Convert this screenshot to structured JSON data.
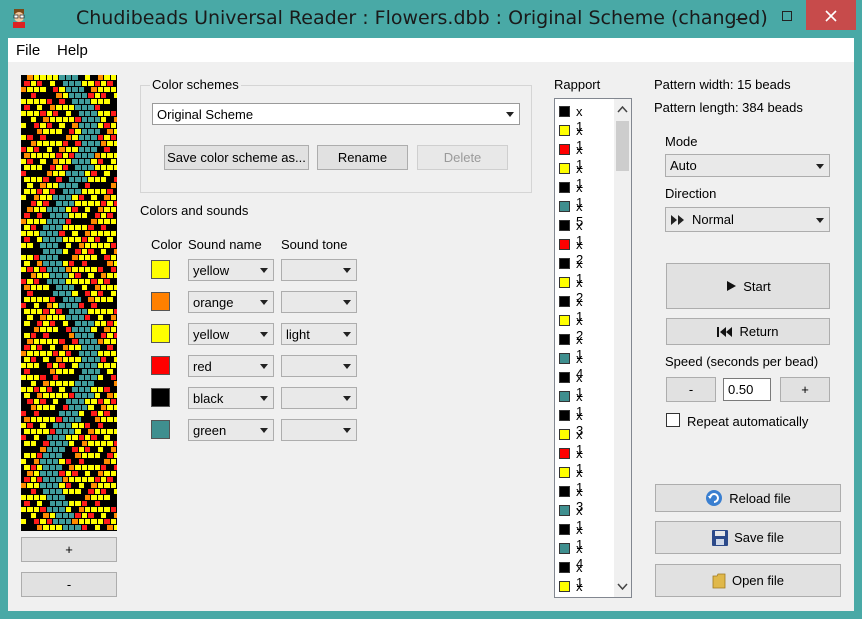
{
  "window": {
    "title": "Chudibeads Universal Reader : Flowers.dbb : Original Scheme  (changed)",
    "minimize": "—",
    "maximize": "☐",
    "close": "✕"
  },
  "menu": {
    "file": "File",
    "help": "Help"
  },
  "left_panel": {
    "plus_label": "+",
    "minus_label": "-"
  },
  "color_schemes": {
    "group_label": "Color schemes",
    "selected": "Original Scheme",
    "save_label": "Save color scheme as...",
    "rename_label": "Rename",
    "delete_label": "Delete"
  },
  "colors_sounds": {
    "section_label": "Colors and sounds",
    "header_color": "Color",
    "header_sound_name": "Sound name",
    "header_sound_tone": "Sound tone",
    "rows": [
      {
        "color": "#ffff00",
        "sound": "yellow",
        "tone": ""
      },
      {
        "color": "#ff8000",
        "sound": "orange",
        "tone": ""
      },
      {
        "color": "#ffff00",
        "sound": "yellow",
        "tone": "light"
      },
      {
        "color": "#ff0000",
        "sound": "red",
        "tone": ""
      },
      {
        "color": "#000000",
        "sound": "black",
        "tone": ""
      },
      {
        "color": "#3f8f8f",
        "sound": "green",
        "tone": ""
      }
    ]
  },
  "rapport": {
    "label": "Rapport",
    "items": [
      {
        "color": "#000000",
        "count": "x 1"
      },
      {
        "color": "#ffff00",
        "count": "x 1"
      },
      {
        "color": "#ff0000",
        "count": "x 1"
      },
      {
        "color": "#ffff00",
        "count": "x 1"
      },
      {
        "color": "#000000",
        "count": "x 1"
      },
      {
        "color": "#3f8f8f",
        "count": "x 5"
      },
      {
        "color": "#000000",
        "count": "x 1"
      },
      {
        "color": "#ff0000",
        "count": "x 2"
      },
      {
        "color": "#000000",
        "count": "x 1"
      },
      {
        "color": "#ffff00",
        "count": "x 2"
      },
      {
        "color": "#000000",
        "count": "x 1"
      },
      {
        "color": "#ffff00",
        "count": "x 2"
      },
      {
        "color": "#000000",
        "count": "x 1"
      },
      {
        "color": "#3f8f8f",
        "count": "x 4"
      },
      {
        "color": "#000000",
        "count": "x 1"
      },
      {
        "color": "#3f8f8f",
        "count": "x 1"
      },
      {
        "color": "#000000",
        "count": "x 3"
      },
      {
        "color": "#ffff00",
        "count": "x 1"
      },
      {
        "color": "#ff0000",
        "count": "x 1"
      },
      {
        "color": "#ffff00",
        "count": "x 1"
      },
      {
        "color": "#000000",
        "count": "x 3"
      },
      {
        "color": "#3f8f8f",
        "count": "x 1"
      },
      {
        "color": "#000000",
        "count": "x 1"
      },
      {
        "color": "#3f8f8f",
        "count": "x 4"
      },
      {
        "color": "#000000",
        "count": "x 1"
      },
      {
        "color": "#ffff00",
        "count": "x 2"
      }
    ]
  },
  "info": {
    "pattern_width": "Pattern width: 15 beads",
    "pattern_length": "Pattern length: 384 beads"
  },
  "controls": {
    "mode_label": "Mode",
    "mode_value": "Auto",
    "direction_label": "Direction",
    "direction_value": "Normal",
    "start_label": "Start",
    "return_label": "Return",
    "speed_label": "Speed (seconds per bead)",
    "speed_minus": "-",
    "speed_value": "0.50",
    "speed_plus": "+",
    "repeat_label": "Repeat automatically"
  },
  "file_buttons": {
    "reload_label": "Reload file",
    "save_label": "Save file",
    "open_label": "Open file"
  }
}
